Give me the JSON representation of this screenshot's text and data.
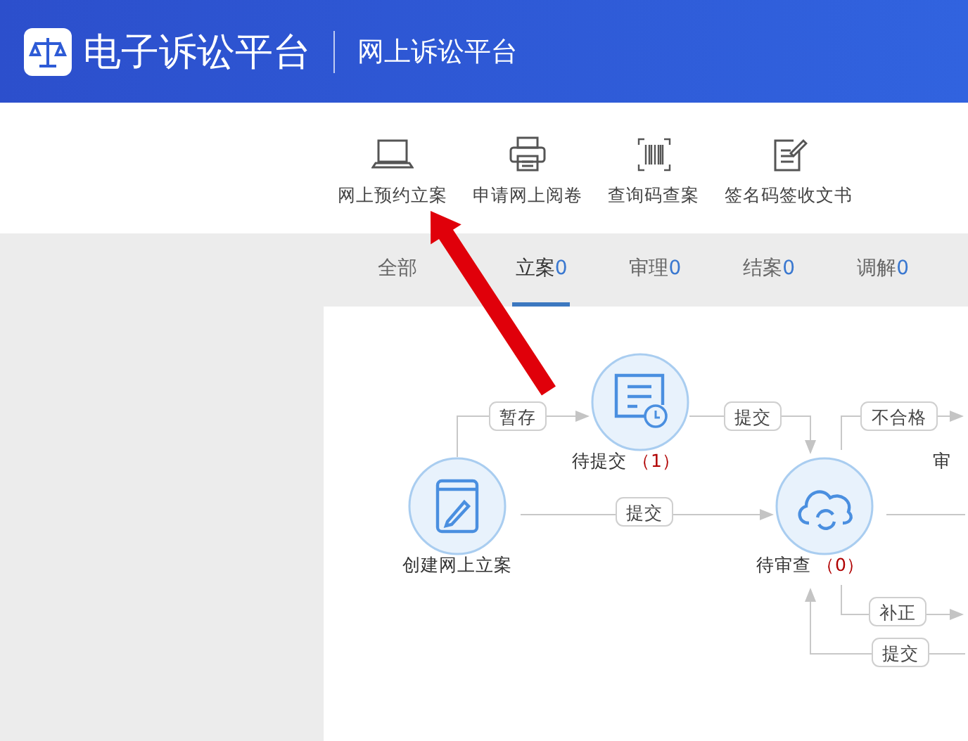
{
  "header": {
    "title": "电子诉讼平台",
    "subtitle": "网上诉讼平台"
  },
  "toolbar": [
    {
      "label": "网上预约立案",
      "kind": "laptop"
    },
    {
      "label": "申请网上阅卷",
      "kind": "printer"
    },
    {
      "label": "查询码查案",
      "kind": "barcode"
    },
    {
      "label": "签名码签收文书",
      "kind": "sign"
    }
  ],
  "tabs": [
    {
      "label": "全部",
      "selected": false
    },
    {
      "label": "立案",
      "count": "0",
      "selected": true
    },
    {
      "label": "审理",
      "count": "0",
      "selected": false
    },
    {
      "label": "结案",
      "count": "0",
      "selected": false
    },
    {
      "label": "调解",
      "count": "0",
      "selected": false
    }
  ],
  "diagram": {
    "nodes": [
      {
        "kind": "create",
        "label": "创建网上立案"
      },
      {
        "kind": "draft",
        "label": "待提交",
        "count": "（1）"
      },
      {
        "kind": "review",
        "label": "待审查",
        "count": "（0）"
      },
      {
        "kind": "partial",
        "label": "审"
      }
    ],
    "edge_labels": [
      "暂存",
      "提交",
      "提交",
      "不合格",
      "补正",
      "提交"
    ]
  }
}
